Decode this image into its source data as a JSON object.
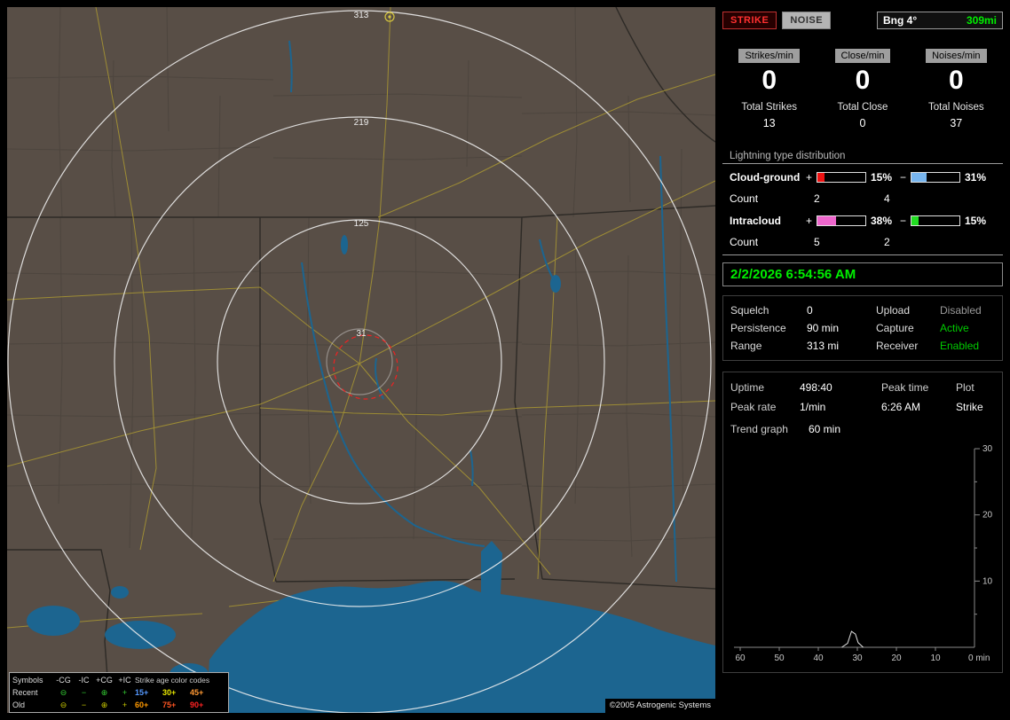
{
  "map": {
    "ring_labels": [
      "313",
      "219",
      "125",
      "31"
    ],
    "copyright": "©2005 Astrogenic Systems",
    "legend": {
      "header": {
        "symbols": "Symbols",
        "cols": [
          "-CG",
          "-IC",
          "+CG",
          "+IC"
        ],
        "age_title": "Strike age color codes"
      },
      "symbols": [
        "⊖",
        "−",
        "⊕",
        "+"
      ],
      "rows": [
        {
          "label": "Recent",
          "symbol_color": "#33cc33",
          "ages": [
            "15+",
            "30+",
            "45+"
          ],
          "age_colors": [
            "#5599ff",
            "#e8e800",
            "#ff9933"
          ]
        },
        {
          "label": "Old",
          "symbol_color": "#c8c800",
          "ages": [
            "60+",
            "75+",
            "90+"
          ],
          "age_colors": [
            "#ff9900",
            "#ff5522",
            "#ff2222"
          ]
        }
      ]
    }
  },
  "sidebar": {
    "tabs": {
      "strike": "STRIKE",
      "noise": "NOISE"
    },
    "bearing": {
      "label": "Bng 4°",
      "range": "309mi"
    },
    "counters": [
      {
        "label": "Strikes/min",
        "value": "0",
        "total_label": "Total Strikes",
        "total": "13"
      },
      {
        "label": "Close/min",
        "value": "0",
        "total_label": "Total Close",
        "total": "0"
      },
      {
        "label": "Noises/min",
        "value": "0",
        "total_label": "Total Noises",
        "total": "37"
      }
    ],
    "distribution": {
      "title": "Lightning type distribution",
      "signs": {
        "plus": "+",
        "minus": "−"
      },
      "rows": [
        {
          "name": "Cloud-ground",
          "plus_fill": 15,
          "plus_color": "#ee1111",
          "plus_pct": "15%",
          "minus_fill": 31,
          "minus_color": "#77b5ee",
          "minus_pct": "31%",
          "count_label": "Count",
          "plus_count": "2",
          "minus_count": "4"
        },
        {
          "name": "Intracloud",
          "plus_fill": 38,
          "plus_color": "#ee66cc",
          "plus_pct": "38%",
          "minus_fill": 15,
          "minus_color": "#22dd22",
          "minus_pct": "15%",
          "count_label": "Count",
          "plus_count": "5",
          "minus_count": "2"
        }
      ]
    },
    "datetime": "2/2/2026 6:54:56 AM",
    "settings": [
      {
        "label": "Squelch",
        "value": "0"
      },
      {
        "label": "Persistence",
        "value": "90 min"
      },
      {
        "label": "Range",
        "value": "313 mi"
      }
    ],
    "statuses": [
      {
        "label": "Upload",
        "value": "Disabled",
        "state": "disabled"
      },
      {
        "label": "Capture",
        "value": "Active",
        "state": "active"
      },
      {
        "label": "Receiver",
        "value": "Enabled",
        "state": "active"
      }
    ],
    "colors": {
      "active": "#00cc00",
      "disabled": "#9a9a9a",
      "accent_green": "#00ee00",
      "accent_red": "#ff3030"
    },
    "stats": {
      "uptime_label": "Uptime",
      "uptime": "498:40",
      "peak_rate_label": "Peak rate",
      "peak_rate": "1/min",
      "peak_time_label": "Peak time",
      "peak_time": "6:26 AM",
      "plot_label": "Plot",
      "plot": "Strike",
      "trend_label": "Trend graph",
      "trend_value": "60 min"
    }
  },
  "chart_data": {
    "type": "line",
    "title": "Strike trend, last 60 minutes",
    "xlabel": "min",
    "x_axis_caption": "0 min",
    "xticks": [
      60,
      50,
      40,
      30,
      20,
      10
    ],
    "yticks": [
      10,
      20,
      30
    ],
    "yticks_minor": [
      5,
      15,
      25
    ],
    "xlim": [
      60,
      0
    ],
    "ylim": [
      0,
      30
    ],
    "legend_position": "none",
    "grid": false,
    "series": [
      {
        "name": "Strike",
        "points": [
          [
            34,
            0
          ],
          [
            32.5,
            0.6
          ],
          [
            31.5,
            2.4
          ],
          [
            30.5,
            2.0
          ],
          [
            29.8,
            0.7
          ],
          [
            28.5,
            0
          ]
        ]
      }
    ]
  }
}
